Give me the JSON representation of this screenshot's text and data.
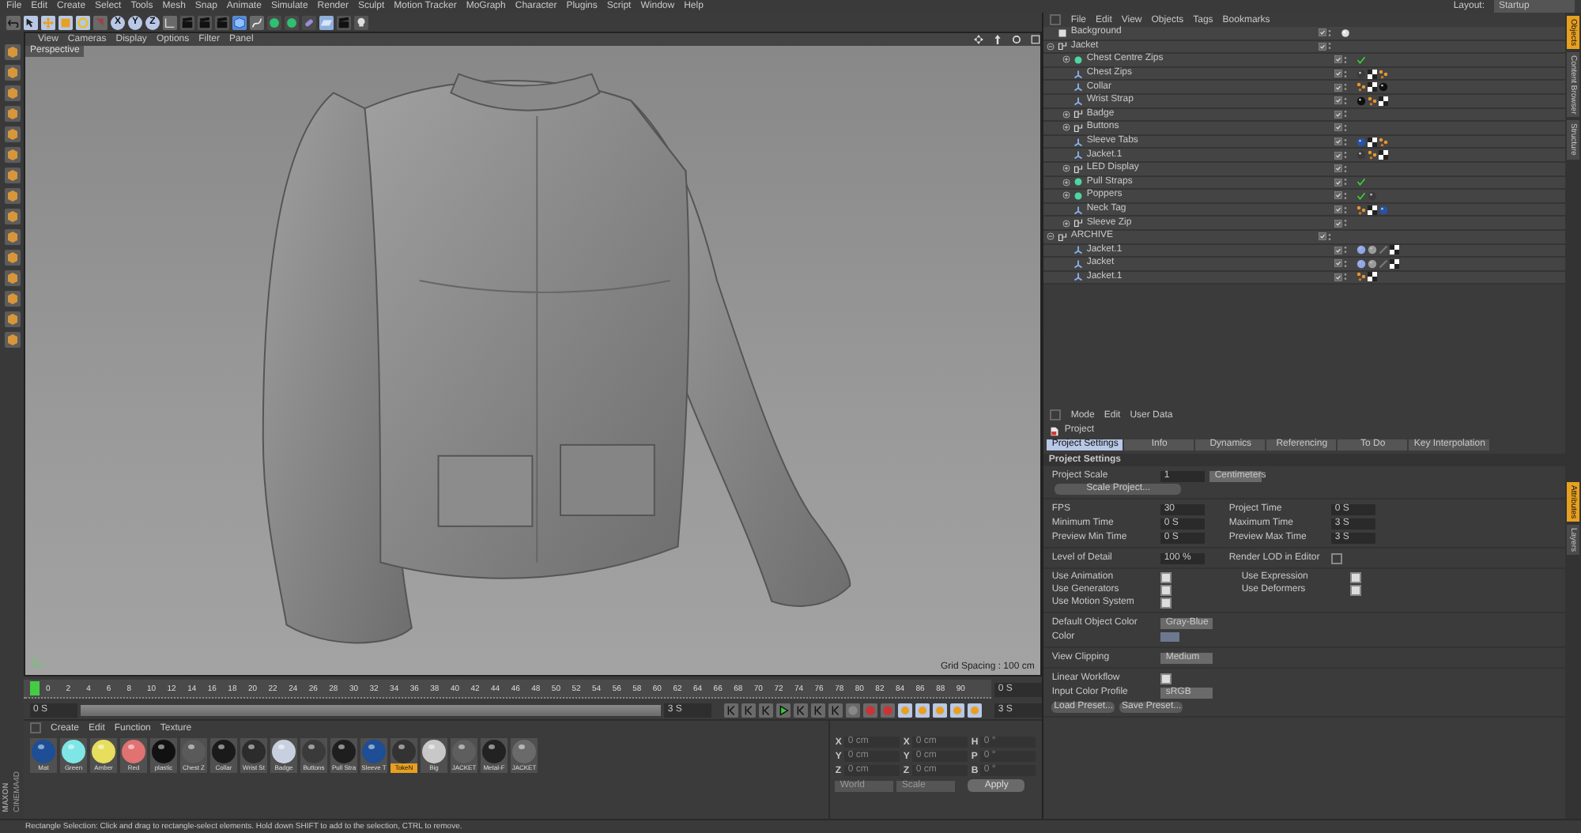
{
  "menu": [
    "File",
    "Edit",
    "Create",
    "Select",
    "Tools",
    "Mesh",
    "Snap",
    "Animate",
    "Simulate",
    "Render",
    "Sculpt",
    "Motion Tracker",
    "MoGraph",
    "Character",
    "Plugins",
    "Script",
    "Window",
    "Help"
  ],
  "layout": {
    "label": "Layout:",
    "value": "Startup"
  },
  "axis_buttons": [
    "X",
    "Y",
    "Z"
  ],
  "viewport": {
    "menu": [
      "View",
      "Cameras",
      "Display",
      "Options",
      "Filter",
      "Panel"
    ],
    "camera": "Perspective",
    "grid": "Grid Spacing : 100 cm"
  },
  "objects": {
    "menu": [
      "File",
      "Edit",
      "View",
      "Objects",
      "Tags",
      "Bookmarks"
    ],
    "tree": [
      {
        "name": "Background",
        "kind": "background",
        "tags": [
          {
            "kind": "sky"
          }
        ]
      },
      {
        "name": "Jacket",
        "kind": "null",
        "expanded": true,
        "children": [
          {
            "name": "Chest Centre Zips",
            "kind": "generator",
            "expanded": false,
            "tags": [
              {
                "kind": "check"
              }
            ]
          },
          {
            "name": "Chest Zips",
            "kind": "polygon",
            "tags": [
              {
                "kind": "mat-dark"
              },
              {
                "kind": "texture"
              },
              {
                "kind": "uvw"
              }
            ]
          },
          {
            "name": "Collar",
            "kind": "polygon",
            "tags": [
              {
                "kind": "uvw"
              },
              {
                "kind": "texture"
              },
              {
                "kind": "mat-black"
              }
            ]
          },
          {
            "name": "Wrist Strap",
            "kind": "polygon",
            "tags": [
              {
                "kind": "mat-black"
              },
              {
                "kind": "uvw"
              },
              {
                "kind": "texture"
              }
            ]
          },
          {
            "name": "Badge",
            "kind": "null",
            "expanded": false
          },
          {
            "name": "Buttons",
            "kind": "null",
            "expanded": false
          },
          {
            "name": "Sleeve Tabs",
            "kind": "polygon",
            "tags": [
              {
                "kind": "mat-blue"
              },
              {
                "kind": "texture"
              },
              {
                "kind": "uvw"
              }
            ]
          },
          {
            "name": "Jacket.1",
            "kind": "polygon",
            "tags": [
              {
                "kind": "mat-dark"
              },
              {
                "kind": "uvw"
              },
              {
                "kind": "texture"
              }
            ]
          },
          {
            "name": "LED Display",
            "kind": "null",
            "expanded": false
          },
          {
            "name": "Pull Straps",
            "kind": "generator",
            "expanded": false,
            "tags": [
              {
                "kind": "check"
              }
            ]
          },
          {
            "name": "Poppers",
            "kind": "generator",
            "expanded": false,
            "tags": [
              {
                "kind": "check"
              },
              {
                "kind": "mat-dark"
              }
            ]
          },
          {
            "name": "Neck Tag",
            "kind": "polygon",
            "tags": [
              {
                "kind": "uvw"
              },
              {
                "kind": "texture"
              },
              {
                "kind": "mat-blue"
              }
            ]
          },
          {
            "name": "Sleeve Zip",
            "kind": "null",
            "expanded": false
          }
        ]
      },
      {
        "name": "ARCHIVE",
        "kind": "null",
        "expanded": true,
        "children": [
          {
            "name": "Jacket.1",
            "kind": "polygon",
            "tags": [
              {
                "kind": "mat-light"
              },
              {
                "kind": "mat-grey"
              },
              {
                "kind": "phong"
              },
              {
                "kind": "texture"
              }
            ]
          },
          {
            "name": "Jacket",
            "kind": "polygon",
            "tags": [
              {
                "kind": "mat-light"
              },
              {
                "kind": "mat-grey"
              },
              {
                "kind": "phong"
              },
              {
                "kind": "texture"
              }
            ]
          },
          {
            "name": "Jacket.1",
            "kind": "polygon",
            "tags": [
              {
                "kind": "uvw"
              },
              {
                "kind": "texture"
              }
            ]
          }
        ]
      }
    ]
  },
  "side_tabs_top": [
    {
      "label": "Objects",
      "selected": true
    },
    {
      "label": "Content Browser",
      "selected": false
    },
    {
      "label": "Structure",
      "selected": false
    }
  ],
  "side_tabs_bottom": [
    {
      "label": "Attributes",
      "selected": true
    },
    {
      "label": "Layers",
      "selected": false
    }
  ],
  "attributes": {
    "menu": [
      "Mode",
      "Edit",
      "User Data"
    ],
    "object": "Project",
    "tabs": [
      {
        "label": "Project Settings",
        "selected": true
      },
      {
        "label": "Info",
        "selected": false
      },
      {
        "label": "Dynamics",
        "selected": false
      },
      {
        "label": "Referencing",
        "selected": false
      },
      {
        "label": "To Do",
        "selected": false
      },
      {
        "label": "Key Interpolation",
        "selected": false
      }
    ],
    "section": "Project Settings",
    "scale": {
      "label": "Project Scale",
      "value": "1",
      "unit": "Centimeters"
    },
    "scale_button": "Scale Project...",
    "time_rows": [
      {
        "label": "FPS",
        "value": "30",
        "label2": "Project Time",
        "value2": "0 S"
      },
      {
        "label": "Minimum Time",
        "value": "0 S",
        "label2": "Maximum Time",
        "value2": "3 S"
      },
      {
        "label": "Preview Min Time",
        "value": "0 S",
        "label2": "Preview Max Time",
        "value2": "3 S"
      }
    ],
    "lod": {
      "label": "Level of Detail",
      "value": "100 %",
      "label2": "Render LOD in Editor",
      "checked": false
    },
    "checks": [
      {
        "label": "Use Animation",
        "checked": true
      },
      {
        "label": "Use Expression",
        "checked": true
      },
      {
        "label": "Use Generators",
        "checked": true
      },
      {
        "label": "Use Deformers",
        "checked": true
      },
      {
        "label": "Use Motion System",
        "checked": true
      }
    ],
    "object_color": {
      "label": "Default Object Color",
      "value": "Gray-Blue"
    },
    "color_label": "Color",
    "clipping": {
      "label": "View Clipping",
      "value": "Medium"
    },
    "linear": {
      "label": "Linear Workflow",
      "checked": true
    },
    "profile": {
      "label": "Input Color Profile",
      "value": "sRGB"
    },
    "buttons": [
      "Load Preset...",
      "Save Preset..."
    ]
  },
  "timeline": {
    "ticks": [
      "0",
      "2",
      "4",
      "6",
      "8",
      "10",
      "12",
      "14",
      "16",
      "18",
      "20",
      "22",
      "24",
      "26",
      "28",
      "30",
      "32",
      "34",
      "36",
      "38",
      "40",
      "42",
      "44",
      "46",
      "48",
      "50",
      "52",
      "54",
      "56",
      "58",
      "60",
      "62",
      "64",
      "66",
      "68",
      "70",
      "72",
      "74",
      "76",
      "78",
      "80",
      "82",
      "84",
      "86",
      "88",
      "90"
    ],
    "current": "0 S",
    "start": "0 S",
    "end": "3 S",
    "end2": "3 S",
    "level": 1
  },
  "materials": {
    "menu": [
      "Create",
      "Edit",
      "Function",
      "Texture"
    ],
    "items": [
      {
        "name": "Mat",
        "color": "#1d4e96",
        "selected": false
      },
      {
        "name": "Green",
        "color": "#7ee6e6",
        "selected": false
      },
      {
        "name": "Amber",
        "color": "#e6de5c",
        "selected": false
      },
      {
        "name": "Red",
        "color": "#e07272",
        "selected": false
      },
      {
        "name": "plastic",
        "color": "#111111",
        "selected": false
      },
      {
        "name": "Chest Z",
        "color": "#5a5a5a",
        "selected": false
      },
      {
        "name": "Collar",
        "color": "#1a1a1a",
        "selected": false
      },
      {
        "name": "Wrist St",
        "color": "#2c2c2c",
        "selected": false
      },
      {
        "name": "Badge",
        "color": "#c8d0e0",
        "selected": false
      },
      {
        "name": "Buttons",
        "color": "#3a3a3a",
        "selected": false
      },
      {
        "name": "Pull Stra",
        "color": "#1e1e1e",
        "selected": false
      },
      {
        "name": "Sleeve T",
        "color": "#1d4e96",
        "selected": false
      },
      {
        "name": "TokeN",
        "color": "#333333",
        "selected": true
      },
      {
        "name": "Big",
        "color": "#c8c8c8",
        "selected": false
      },
      {
        "name": "JACKET",
        "color": "#5e5e5e",
        "selected": false
      },
      {
        "name": "Metal-F",
        "color": "#222222",
        "selected": false
      },
      {
        "name": "JACKET",
        "color": "#6a6a6a",
        "selected": false
      }
    ]
  },
  "coords": {
    "rows": [
      {
        "a": "X",
        "p": "0 cm",
        "b": "X",
        "s": "0 cm",
        "c": "H",
        "r": "0 °"
      },
      {
        "a": "Y",
        "p": "0 cm",
        "b": "Y",
        "s": "0 cm",
        "c": "P",
        "r": "0 °"
      },
      {
        "a": "Z",
        "p": "0 cm",
        "b": "Z",
        "s": "0 cm",
        "c": "B",
        "r": "0 °"
      }
    ],
    "space": "World",
    "mode": "Scale",
    "apply": "Apply"
  },
  "logo": {
    "brand": "MAXON",
    "product": "CINEMA4D"
  },
  "status": "Rectangle Selection: Click and drag to rectangle-select elements. Hold down SHIFT to add to the selection, CTRL to remove."
}
